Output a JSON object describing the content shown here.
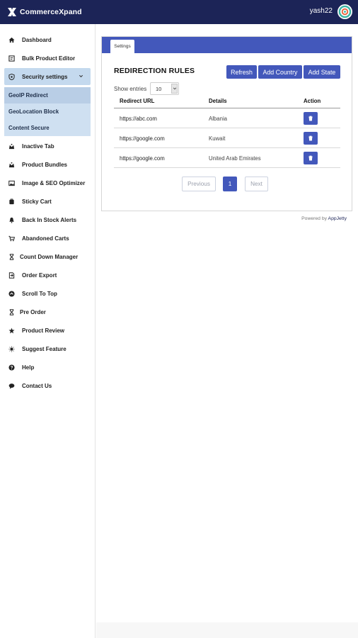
{
  "app": {
    "name": "CommerceXpand",
    "username": "yash22"
  },
  "sidebar": {
    "items": [
      {
        "label": "Dashboard",
        "icon": "home-icon"
      },
      {
        "label": "Bulk Product Editor",
        "icon": "edit-icon"
      },
      {
        "label": "Security settings",
        "icon": "shield-icon"
      },
      {
        "label": "Inactive Tab",
        "icon": "tab-icon"
      },
      {
        "label": "Product Bundles",
        "icon": "bundle-icon"
      },
      {
        "label": "Image & SEO Optimizer",
        "icon": "image-icon"
      },
      {
        "label": "Sticky Cart",
        "icon": "cart-icon"
      },
      {
        "label": "Back In Stock Alerts",
        "icon": "bell-icon"
      },
      {
        "label": "Abandoned Carts",
        "icon": "cart-icon"
      },
      {
        "label": "Count Down Manager",
        "icon": "hourglass-icon"
      },
      {
        "label": "Order Export",
        "icon": "export-icon"
      },
      {
        "label": "Scroll To Top",
        "icon": "arrow-up-icon"
      },
      {
        "label": "Pre Order",
        "icon": "hourglass-icon"
      },
      {
        "label": "Product Review",
        "icon": "star-icon"
      },
      {
        "label": "Suggest Feature",
        "icon": "lightbulb-icon"
      },
      {
        "label": "Help",
        "icon": "help-icon"
      },
      {
        "label": "Contact Us",
        "icon": "chat-icon"
      }
    ],
    "security_submenu": [
      "GeoIP Redirect",
      "GeoLocation Block",
      "Content Secure"
    ]
  },
  "main": {
    "tab": "Settings",
    "title": "REDIRECTION RULES",
    "buttons": {
      "refresh": "Refresh",
      "add_country": "Add Country",
      "add_state": "Add State"
    },
    "show_entries_label": "Show entries",
    "entries_value": "10",
    "columns": [
      "Redirect URL",
      "Details",
      "Action"
    ],
    "rows": [
      {
        "url": "https://abc.com",
        "details": "Albania"
      },
      {
        "url": "https://google.com",
        "details": "Kuwait"
      },
      {
        "url": "https://google.com",
        "details": "United Arab Emirates"
      }
    ],
    "pagination": {
      "previous": "Previous",
      "current": "1",
      "next": "Next"
    }
  },
  "footer": {
    "powered_by": "Powered by",
    "brand": "AppJetty"
  },
  "colors": {
    "topbar": "#1c2457",
    "accent": "#4358bb",
    "submenu": "#cfe0f1"
  }
}
